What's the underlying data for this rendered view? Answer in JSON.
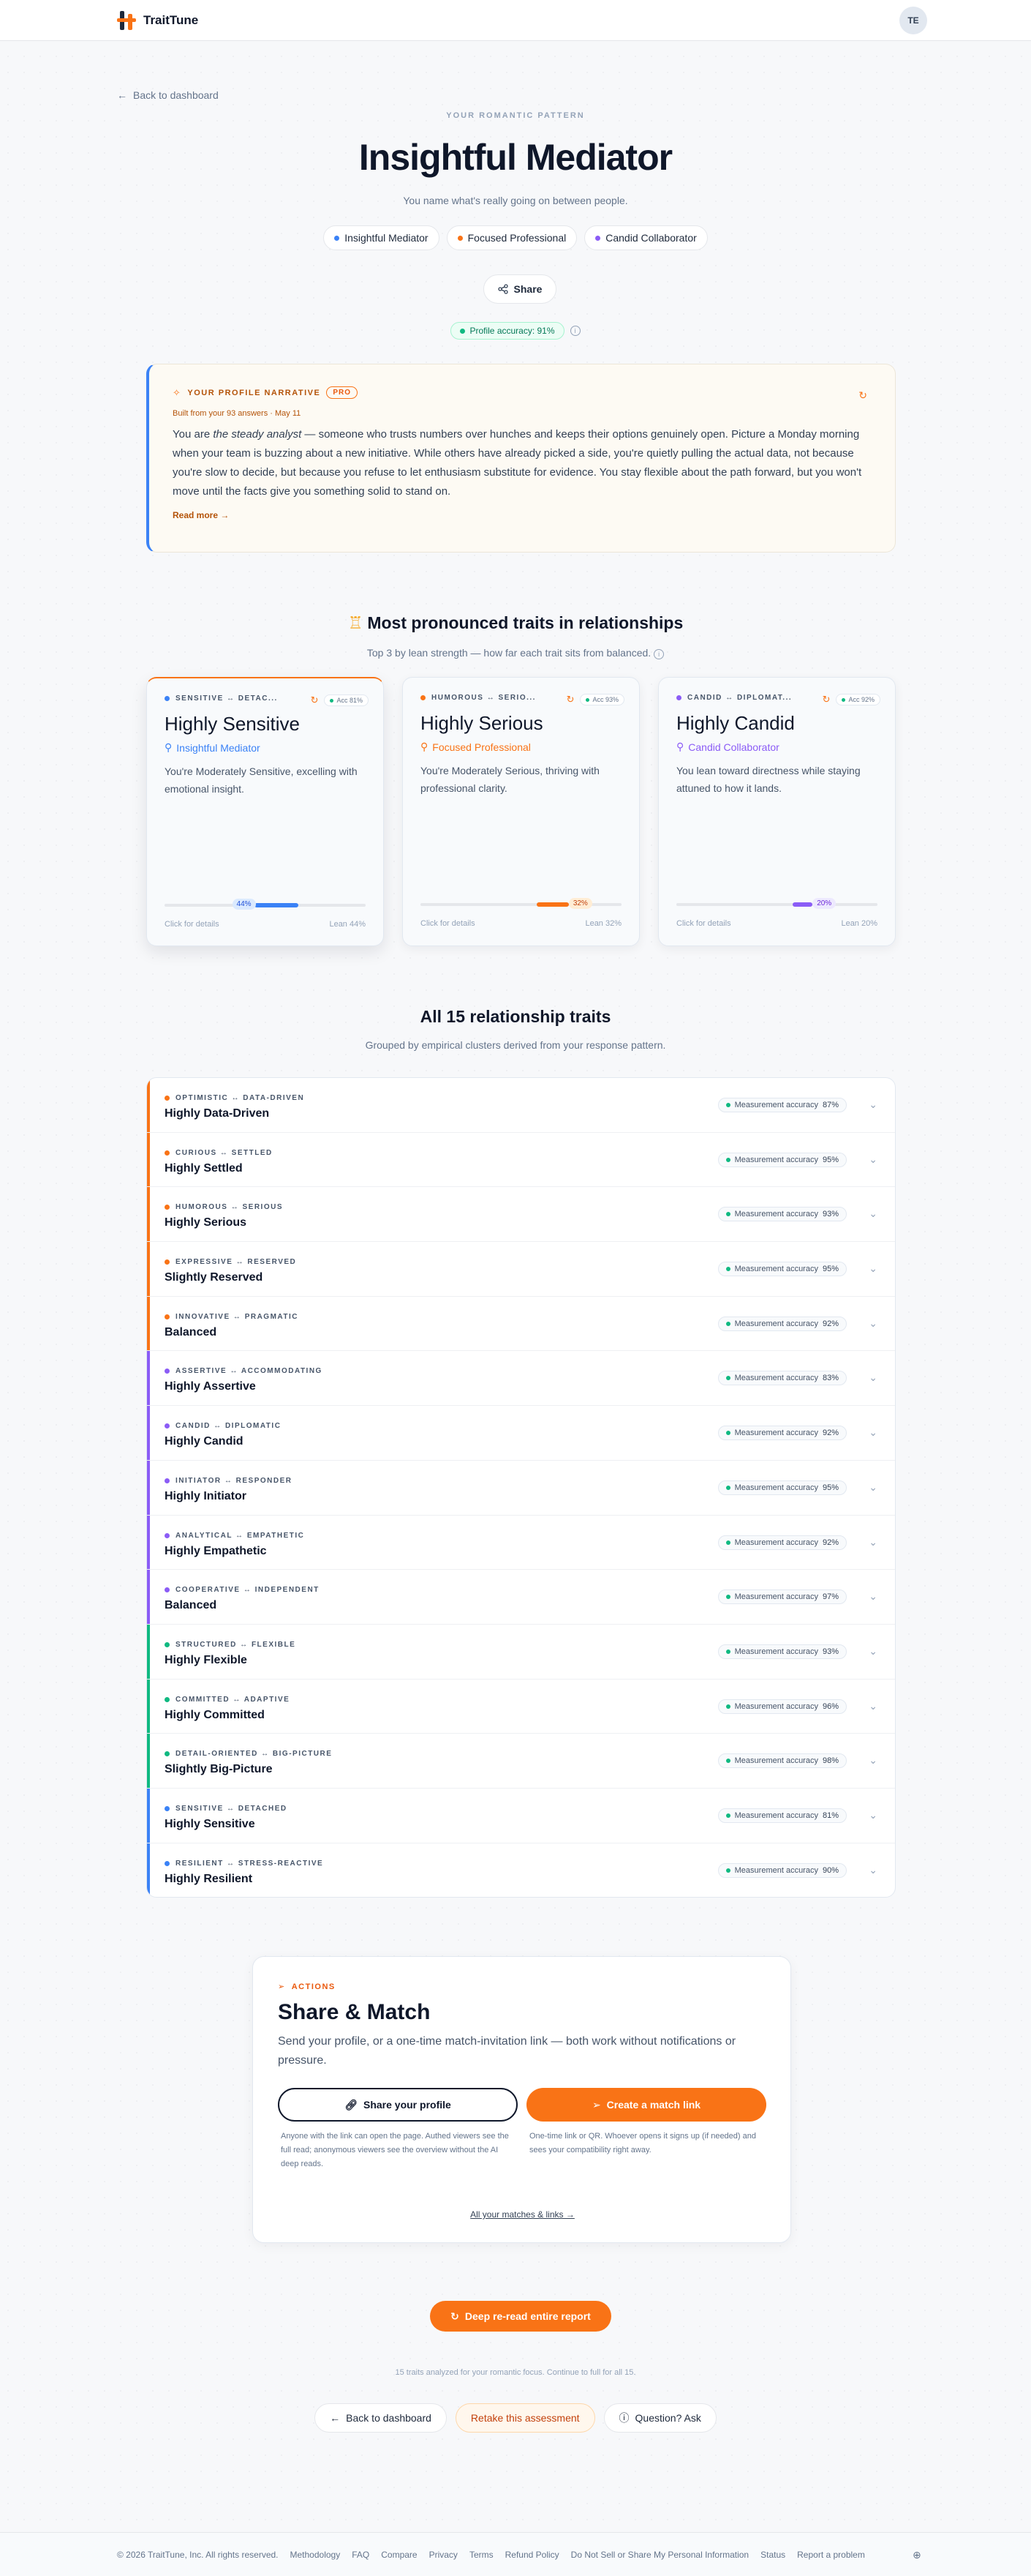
{
  "header": {
    "brand": "TraitTune",
    "avatar_initials": "TE"
  },
  "hero": {
    "back_label": "Back to dashboard",
    "eyebrow": "YOUR ROMANTIC PATTERN",
    "title": "Insightful Mediator",
    "subtitle": "You name what's really going on between people.",
    "chips": [
      {
        "label": "Insightful Mediator",
        "color": "#3b82f6"
      },
      {
        "label": "Focused Professional",
        "color": "#f97316"
      },
      {
        "label": "Candid Collaborator",
        "color": "#8b5cf6"
      }
    ],
    "share_label": "Share",
    "accuracy_label": "Profile accuracy: 91%"
  },
  "narrative": {
    "heading": "YOUR PROFILE NARRATIVE",
    "badge": "PRO",
    "built": "Built from your 93 answers · May 11",
    "text_before": "You are ",
    "text_em": "the steady analyst",
    "text_after": " — someone who trusts numbers over hunches and keeps their options genuinely open. Picture a Monday morning when your team is buzzing about a new initiative. While others have already picked a side, you're quietly pulling the actual data, not because you're slow to decide, but because you refuse to let enthusiasm substitute for evidence. You stay flexible about the path forward, but you won't move until the facts give you something solid to stand on.",
    "read_more": "Read more →"
  },
  "pronounced": {
    "title": "Most pronounced traits in relationships",
    "subtitle": "Top 3 by lean strength — how far each trait sits from balanced.",
    "cards": [
      {
        "pair": "SENSITIVE ↔ DETAC...",
        "acc": "Acc 81%",
        "title": "Highly Sensitive",
        "type": "Insightful Mediator",
        "type_color": "#3b82f6",
        "dot_color": "#3b82f6",
        "desc": "You're Moderately Sensitive, excelling with emotional insight.",
        "bar_label": "44%",
        "lean_percent": 44,
        "click": "Click for details",
        "lean": "Lean 44%"
      },
      {
        "pair": "HUMOROUS ↔ SERIO...",
        "acc": "Acc 93%",
        "title": "Highly Serious",
        "type": "Focused Professional",
        "type_color": "#f97316",
        "dot_color": "#f97316",
        "desc": "You're Moderately Serious, thriving with professional clarity.",
        "bar_label": "32%",
        "lean_percent": 32,
        "click": "Click for details",
        "lean": "Lean 32%"
      },
      {
        "pair": "CANDID ↔ DIPLOMAT...",
        "acc": "Acc 92%",
        "title": "Highly Candid",
        "type": "Candid Collaborator",
        "type_color": "#8b5cf6",
        "dot_color": "#8b5cf6",
        "desc": "You lean toward directness while staying attuned to how it lands.",
        "bar_label": "20%",
        "lean_percent": 20,
        "click": "Click for details",
        "lean": "Lean 20%"
      }
    ]
  },
  "all_traits": {
    "title": "All 15 relationship traits",
    "subtitle": "Grouped by empirical clusters derived from your response pattern.",
    "acc_label": "Measurement accuracy",
    "rows": [
      {
        "pair": "OPTIMISTIC ↔ DATA-DRIVEN",
        "level": "Highly Data-Driven",
        "acc": "87%",
        "color": "#f97316"
      },
      {
        "pair": "CURIOUS ↔ SETTLED",
        "level": "Highly Settled",
        "acc": "95%",
        "color": "#f97316"
      },
      {
        "pair": "HUMOROUS ↔ SERIOUS",
        "level": "Highly Serious",
        "acc": "93%",
        "color": "#f97316"
      },
      {
        "pair": "EXPRESSIVE ↔ RESERVED",
        "level": "Slightly Reserved",
        "acc": "95%",
        "color": "#f97316"
      },
      {
        "pair": "INNOVATIVE ↔ PRAGMATIC",
        "level": "Balanced",
        "acc": "92%",
        "color": "#f97316"
      },
      {
        "pair": "ASSERTIVE ↔ ACCOMMODATING",
        "level": "Highly Assertive",
        "acc": "83%",
        "color": "#8b5cf6"
      },
      {
        "pair": "CANDID ↔ DIPLOMATIC",
        "level": "Highly Candid",
        "acc": "92%",
        "color": "#8b5cf6"
      },
      {
        "pair": "INITIATOR ↔ RESPONDER",
        "level": "Highly Initiator",
        "acc": "95%",
        "color": "#8b5cf6"
      },
      {
        "pair": "ANALYTICAL ↔ EMPATHETIC",
        "level": "Highly Empathetic",
        "acc": "92%",
        "color": "#8b5cf6"
      },
      {
        "pair": "COOPERATIVE ↔ INDEPENDENT",
        "level": "Balanced",
        "acc": "97%",
        "color": "#8b5cf6"
      },
      {
        "pair": "STRUCTURED ↔ FLEXIBLE",
        "level": "Highly Flexible",
        "acc": "93%",
        "color": "#10b981"
      },
      {
        "pair": "COMMITTED ↔ ADAPTIVE",
        "level": "Highly Committed",
        "acc": "96%",
        "color": "#10b981"
      },
      {
        "pair": "DETAIL-ORIENTED ↔ BIG-PICTURE",
        "level": "Slightly Big-Picture",
        "acc": "98%",
        "color": "#10b981"
      },
      {
        "pair": "SENSITIVE ↔ DETACHED",
        "level": "Highly Sensitive",
        "acc": "81%",
        "color": "#3b82f6"
      },
      {
        "pair": "RESILIENT ↔ STRESS-REACTIVE",
        "level": "Highly Resilient",
        "acc": "90%",
        "color": "#3b82f6"
      }
    ]
  },
  "share_match": {
    "eyebrow": "ACTIONS",
    "title": "Share & Match",
    "desc": "Send your profile, or a one-time match-invitation link — both work without notifications or pressure.",
    "btn_share": "Share your profile",
    "btn_match": "Create a match link",
    "note_share": "Anyone with the link can open the page. Authed viewers see the full read; anonymous viewers see the overview without the AI deep reads.",
    "note_match": "One-time link or QR. Whoever opens it signs up (if needed) and sees your compatibility right away.",
    "all_link": "All your matches & links →"
  },
  "deep_label": "Deep re-read entire report",
  "analyzed_text": "15 traits analyzed for your romantic focus. Continue to full for all 15.",
  "bottom": {
    "back": "Back to dashboard",
    "retake": "Retake this assessment",
    "question": "Question? Ask"
  },
  "footer": {
    "copyright": "© 2026 TraitTune, Inc. All rights reserved.",
    "links": [
      "Methodology",
      "FAQ",
      "Compare",
      "Privacy",
      "Terms",
      "Refund Policy",
      "Do Not Sell or Share My Personal Information",
      "Status",
      "Report a problem"
    ]
  },
  "colors": {
    "accent": "#f97316",
    "blue": "#3b82f6",
    "violet": "#8b5cf6",
    "green": "#10b981"
  }
}
